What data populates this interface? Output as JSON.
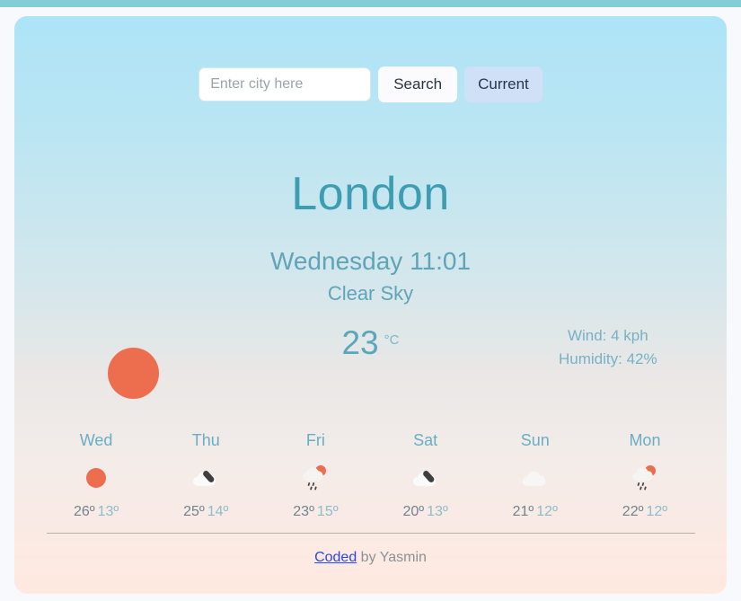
{
  "search": {
    "placeholder": "Enter city here",
    "value": "",
    "search_label": "Search",
    "current_label": "Current"
  },
  "current": {
    "city": "London",
    "date_time": "Wednesday 11:01",
    "description": "Clear Sky",
    "temperature": "23",
    "unit": "°C",
    "icon": "sun-icon",
    "wind": "Wind: 4 kph",
    "humidity": "Humidity: 42%"
  },
  "forecast": [
    {
      "day": "Wed",
      "icon": "sun-icon",
      "high": "26º",
      "low": "13º"
    },
    {
      "day": "Thu",
      "icon": "cloud-dark-streak-icon",
      "high": "25º",
      "low": "14º"
    },
    {
      "day": "Fri",
      "icon": "sun-cloud-rain-icon",
      "high": "23º",
      "low": "15º"
    },
    {
      "day": "Sat",
      "icon": "cloud-dark-streak-icon",
      "high": "20º",
      "low": "13º"
    },
    {
      "day": "Sun",
      "icon": "cloud-icon",
      "high": "21º",
      "low": "12º"
    },
    {
      "day": "Mon",
      "icon": "sun-cloud-rain-icon",
      "high": "22º",
      "low": "12º"
    }
  ],
  "footer": {
    "link_text": "Coded",
    "suffix_text": " by Yasmin"
  },
  "colors": {
    "top_bar": "#82cdd8",
    "card_top": "#ade4f8",
    "card_bottom": "#ffe9e0",
    "title": "#3d9eb2",
    "accent_text": "#60a4b8",
    "sun": "#ec6e4f",
    "current_button": "#cfe0f7",
    "link": "#2b47e8"
  }
}
